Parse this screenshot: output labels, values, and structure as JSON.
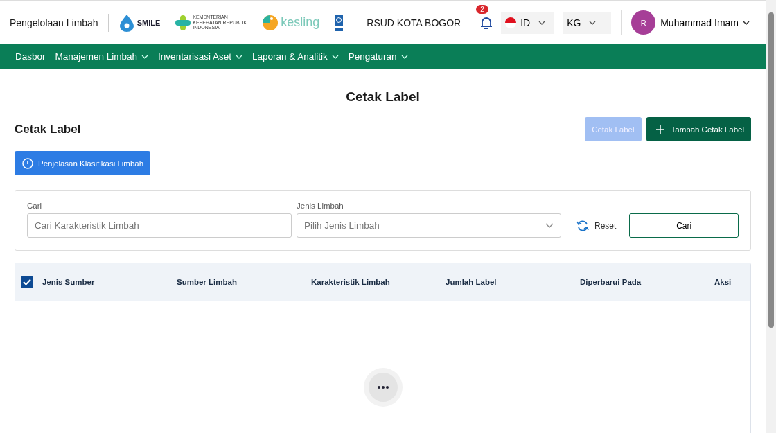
{
  "header": {
    "app_title": "Pengelolaan Limbah",
    "logos": [
      {
        "kind": "smile",
        "text": "SMILE"
      },
      {
        "kind": "kemenkes",
        "text": "KEMENTERIAN KESEHATAN REPUBLIK INDONESIA"
      },
      {
        "kind": "kesling",
        "text": "kesling"
      },
      {
        "kind": "undp"
      }
    ],
    "facility": "RSUD KOTA BOGOR",
    "notifications": "2",
    "language": "ID",
    "unit": "KG",
    "user": {
      "initial": "R",
      "name": "Muhammad Imam"
    }
  },
  "nav": [
    {
      "label": "Dasbor",
      "dropdown": false
    },
    {
      "label": "Manajemen Limbah",
      "dropdown": true
    },
    {
      "label": "Inventarisasi Aset",
      "dropdown": true
    },
    {
      "label": "Laporan & Analitik",
      "dropdown": true
    },
    {
      "label": "Pengaturan",
      "dropdown": true
    }
  ],
  "page_title": "Cetak Label",
  "section_title": "Cetak Label",
  "actions": [
    {
      "label": "Cetak Label",
      "kind": "print",
      "disabled": true
    },
    {
      "label": "Tambah Cetak Label",
      "kind": "add",
      "disabled": false
    }
  ],
  "info_button": "Penjelasan Klasifikasi Limbah",
  "filters": {
    "search": {
      "label": "Cari",
      "placeholder": "Cari Karakteristik Limbah"
    },
    "type": {
      "label": "Jenis Limbah",
      "placeholder": "Pilih Jenis Limbah"
    },
    "reset": "Reset",
    "submit": "Cari"
  },
  "table": {
    "select_all": {
      "checked": true
    },
    "columns": [
      "Jenis Sumber",
      "Sumber Limbah",
      "Karakteristik Limbah",
      "Jumlah Label",
      "Diperbarui Pada",
      "Aksi"
    ]
  }
}
